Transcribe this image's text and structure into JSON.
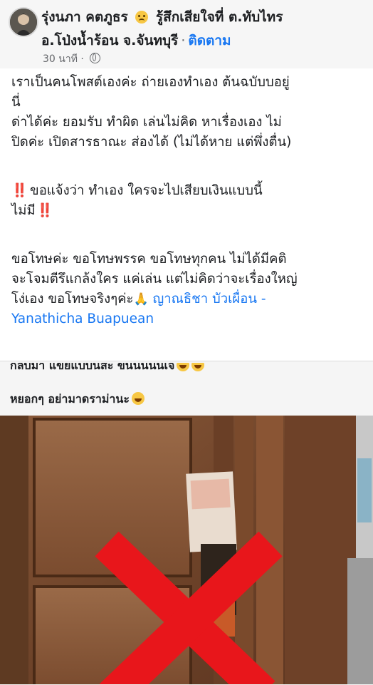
{
  "header": {
    "author_name": "รุ่งนภา คตภูธร",
    "feeling_text": "รู้สึกเสียใจที่ ต.ทับไทร",
    "location_line": "อ.โป่งน้ำร้อน จ.จันทบุรี",
    "follow_label": "ติดตาม",
    "timestamp": "30 นาที",
    "audience_icon": "globe-icon",
    "feeling_icon": "sad-face-icon"
  },
  "post": {
    "line1": "เราเป็นคนโพสต์เองค่ะ ถ่ายเองทำเอง ต้นฉบับบอยู่",
    "line2": "นี่",
    "line3": "ด่าได้ค่ะ ยอมรับ ทำผิด เล่นไม่คิด หาเรื่องเอง ไม่",
    "line4": "ปิดค่ะ เปิดสารธาณะ ส่องได้ (ไม่ได้หาย แต่พึ่งตื่น)",
    "bang": "‼️",
    "line5": "ขอแจ้งว่า ทำเอง ใครจะไปเสียบเงินแบบนี้",
    "line6": "ไม่มี",
    "line7": "ขอโทษค่ะ ขอโทษพรรค ขอโทษทุกคน ไม่ได้มีคติ",
    "line8": "จะโจมตีรึแกล้งใคร แค่เล่น แต่ไม่คิดว่าจะเรื่องใหญ่",
    "line9_prefix": "โง่เอง ขอโทษจริงๆค่ะ",
    "pray_emoji": "🙏",
    "mention_part1": "ญาณธิชา บัวเผื่อน -",
    "mention_part2": "Yanathicha Buapuean"
  },
  "embedded": {
    "clipped_text": "กลับมา แขยแบบนสะ ขนนนนนเจ",
    "caption": "หยอกๆ อย่ามาดราม่านะ",
    "caption_icon": "laughing-face-icon",
    "photo_icon": "door-with-banknote-crossed-out-image"
  },
  "colors": {
    "link": "#1877f2",
    "cross": "#e8161b",
    "door": "#7a4a2c",
    "secondary_text": "#65676b"
  }
}
